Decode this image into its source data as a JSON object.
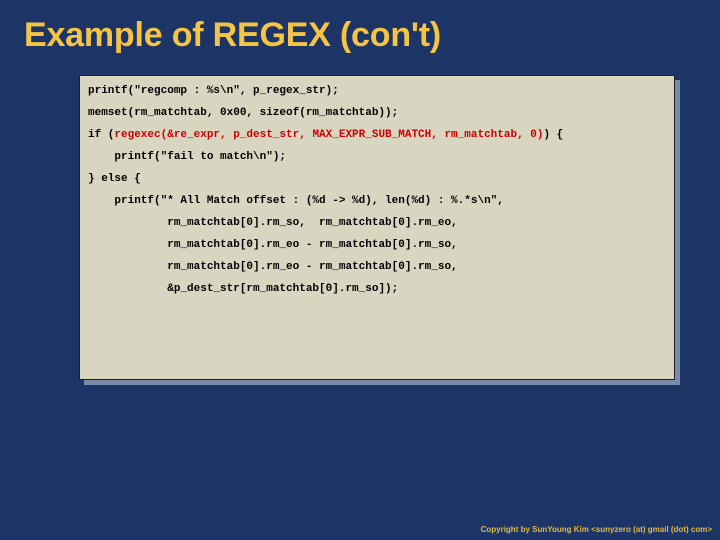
{
  "title": "Example of REGEX (con't)",
  "code": {
    "l01": "printf(\"regcomp : %s\\n\", p_regex_str);",
    "l02": "",
    "l03": "memset(rm_matchtab, 0x00, sizeof(rm_matchtab));",
    "l04": "",
    "l05a": "if (",
    "l05b": "regexec(&re_expr, p_dest_str, MAX_EXPR_SUB_MATCH, rm_matchtab, 0)",
    "l05c": ") {",
    "l06": "",
    "l07": "    printf(\"fail to match\\n\");",
    "l08": "",
    "l09": "} else {",
    "l10": "",
    "l11": "    printf(\"* All Match offset : (%d -> %d), len(%d) : %.*s\\n\",",
    "l12": "",
    "l13": "            rm_matchtab[0].rm_so,  rm_matchtab[0].rm_eo,",
    "l14": "",
    "l15": "            rm_matchtab[0].rm_eo - rm_matchtab[0].rm_so,",
    "l16": "",
    "l17": "            rm_matchtab[0].rm_eo - rm_matchtab[0].rm_so,",
    "l18": "",
    "l19": "            &p_dest_str[rm_matchtab[0].rm_so]);"
  },
  "footer": "Copyright by SunYoung Kim <sunyzero (at) gmail (dot) com>"
}
